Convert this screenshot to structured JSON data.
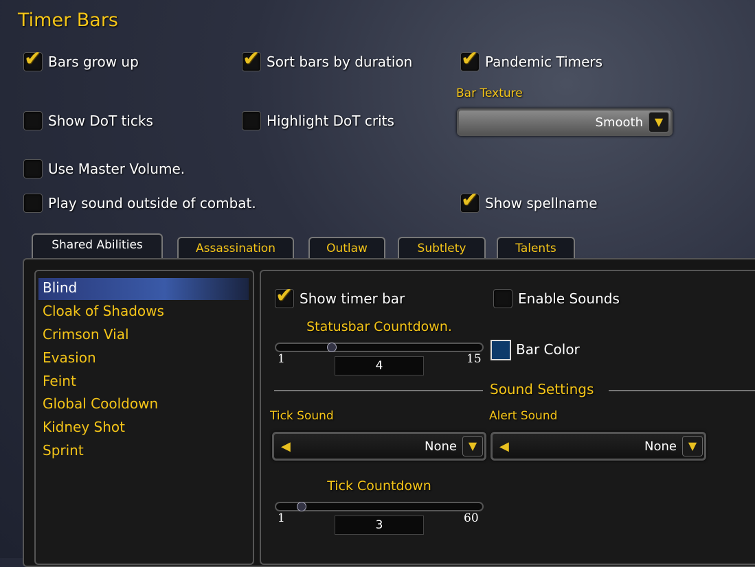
{
  "title": "Timer Bars",
  "options": {
    "bars_grow_up": {
      "label": "Bars grow up",
      "checked": true
    },
    "sort_bars": {
      "label": "Sort bars by duration",
      "checked": true
    },
    "pandemic": {
      "label": "Pandemic Timers",
      "checked": true
    },
    "dot_ticks": {
      "label": "Show DoT ticks",
      "checked": false
    },
    "dot_crits": {
      "label": "Highlight DoT crits",
      "checked": false
    },
    "master_volume": {
      "label": "Use Master Volume.",
      "checked": false
    },
    "sound_outside": {
      "label": "Play sound outside of combat.",
      "checked": false
    },
    "spellname": {
      "label": "Show spellname",
      "checked": true
    }
  },
  "bar_texture": {
    "label": "Bar Texture",
    "value": "Smooth"
  },
  "tabs": [
    {
      "label": "Shared Abilities",
      "active": true
    },
    {
      "label": "Assassination"
    },
    {
      "label": "Outlaw"
    },
    {
      "label": "Subtlety"
    },
    {
      "label": "Talents"
    }
  ],
  "abilities": [
    "Blind",
    "Cloak of Shadows",
    "Crimson Vial",
    "Evasion",
    "Feint",
    "Global Cooldown",
    "Kidney Shot",
    "Sprint"
  ],
  "selected_ability": "Blind",
  "detail": {
    "show_timer_bar": {
      "label": "Show timer bar",
      "checked": true
    },
    "enable_sounds": {
      "label": "Enable Sounds",
      "checked": false
    },
    "statusbar": {
      "label": "Statusbar Countdown.",
      "min": "1",
      "max": "15",
      "value": "4"
    },
    "bar_color": {
      "label": "Bar Color",
      "color": "#0e3a6a"
    },
    "sound_settings": "Sound Settings",
    "tick_sound": {
      "label": "Tick Sound",
      "value": "None"
    },
    "alert_sound": {
      "label": "Alert Sound",
      "value": "None"
    },
    "tick_countdown": {
      "label": "Tick Countdown",
      "min": "1",
      "max": "60",
      "value": "3"
    }
  }
}
